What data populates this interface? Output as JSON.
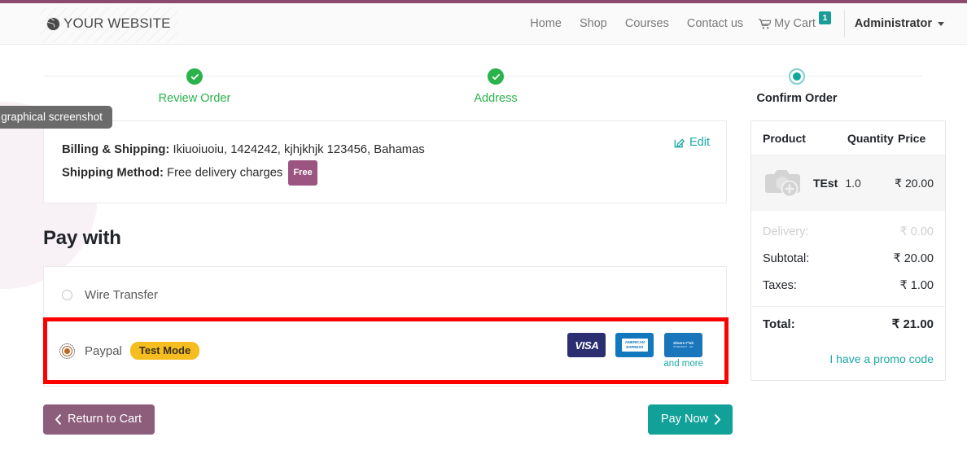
{
  "header": {
    "brand": {
      "icon": "globe-icon",
      "name": "YOUR WEBSITE"
    },
    "nav_links": [
      {
        "label": "Home"
      },
      {
        "label": "Shop"
      },
      {
        "label": "Courses"
      },
      {
        "label": "Contact us"
      }
    ],
    "cart": {
      "icon": "shopping-cart-icon",
      "label": "My Cart",
      "count": "1",
      "badge_color": "#1a9d96"
    },
    "user": {
      "label": "Administrator",
      "icon": "chevron-down-icon"
    }
  },
  "stepper": {
    "steps": [
      {
        "label": "Review Order",
        "state": "done",
        "icon": "check-circle-icon"
      },
      {
        "label": "Address",
        "state": "done",
        "icon": "check-circle-icon"
      },
      {
        "label": "Confirm Order",
        "state": "current",
        "icon": "dot-icon"
      }
    ],
    "done_color": "#2ab34a",
    "current_color": "#12a79d"
  },
  "tooltip": {
    "text": "e graphical screenshot"
  },
  "address_card": {
    "billing_label": "Billing & Shipping:",
    "billing_value": "Ikiuoiuoiu, 1424242, kjhjkhjk 123456, Bahamas",
    "shipping_label": "Shipping Method:",
    "shipping_value": "Free delivery charges",
    "shipping_badge": "Free",
    "edit_label": "Edit",
    "edit_icon": "pencil-square-icon"
  },
  "payment": {
    "title": "Pay with",
    "options": [
      {
        "label": "Wire Transfer",
        "selected": false
      },
      {
        "label": "Paypal",
        "selected": true,
        "badge": "Test Mode"
      }
    ],
    "card_logos": [
      {
        "name": "visa-logo",
        "text": "VISA"
      },
      {
        "name": "amex-logo",
        "line1": "AMERICAN",
        "line2": "EXPRESS"
      },
      {
        "name": "diners-club-logo",
        "line1": "Diners Club",
        "line2": "INTERNATIONAL"
      }
    ],
    "and_more_label": "and more",
    "highlight_color": "#ff0000"
  },
  "footer": {
    "return_label": "Return to Cart",
    "return_icon": "chevron-left-icon",
    "pay_label": "Pay Now",
    "pay_icon": "chevron-right-icon"
  },
  "summary": {
    "columns": [
      "Product",
      "Quantity",
      "Price"
    ],
    "items": [
      {
        "thumb": "image-placeholder-icon",
        "name": "TEst",
        "quantity": "1.0",
        "price": "₹ 20.00"
      }
    ],
    "lines": [
      {
        "label": "Delivery:",
        "value": "₹ 0.00",
        "muted": true
      },
      {
        "label": "Subtotal:",
        "value": "₹ 20.00",
        "muted": false
      },
      {
        "label": "Taxes:",
        "value": "₹ 1.00",
        "muted": false
      }
    ],
    "total_label": "Total:",
    "total_value": "₹ 21.00",
    "promo_label": "I have a promo code"
  }
}
